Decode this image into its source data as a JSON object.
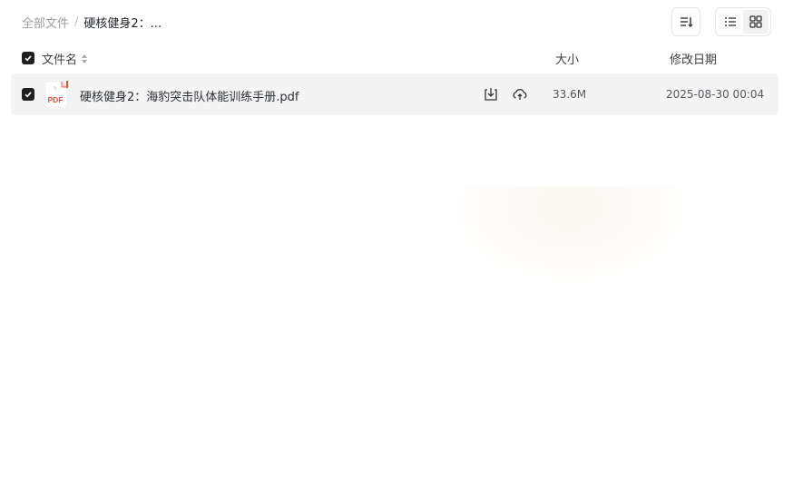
{
  "breadcrumb": {
    "root": "全部文件",
    "separator": "/",
    "current": "硬核健身2：..."
  },
  "toolbar": {
    "sort_icon": "sort-icon",
    "list_view_icon": "list-view-icon",
    "grid_view_icon": "grid-view-icon",
    "active_view": "list"
  },
  "header": {
    "name": "文件名",
    "size": "大小",
    "date": "修改日期"
  },
  "files": [
    {
      "name": "硬核健身2：海豹突击队体能训练手册.pdf",
      "type_label": "PDF",
      "size": "33.6M",
      "modified": "2025-08-30 00:04",
      "checked": true
    }
  ],
  "colors": {
    "row_bg": "#f4f4f5",
    "pdf_red": "#e84c3d",
    "checkbox": "#1f1f1f"
  }
}
